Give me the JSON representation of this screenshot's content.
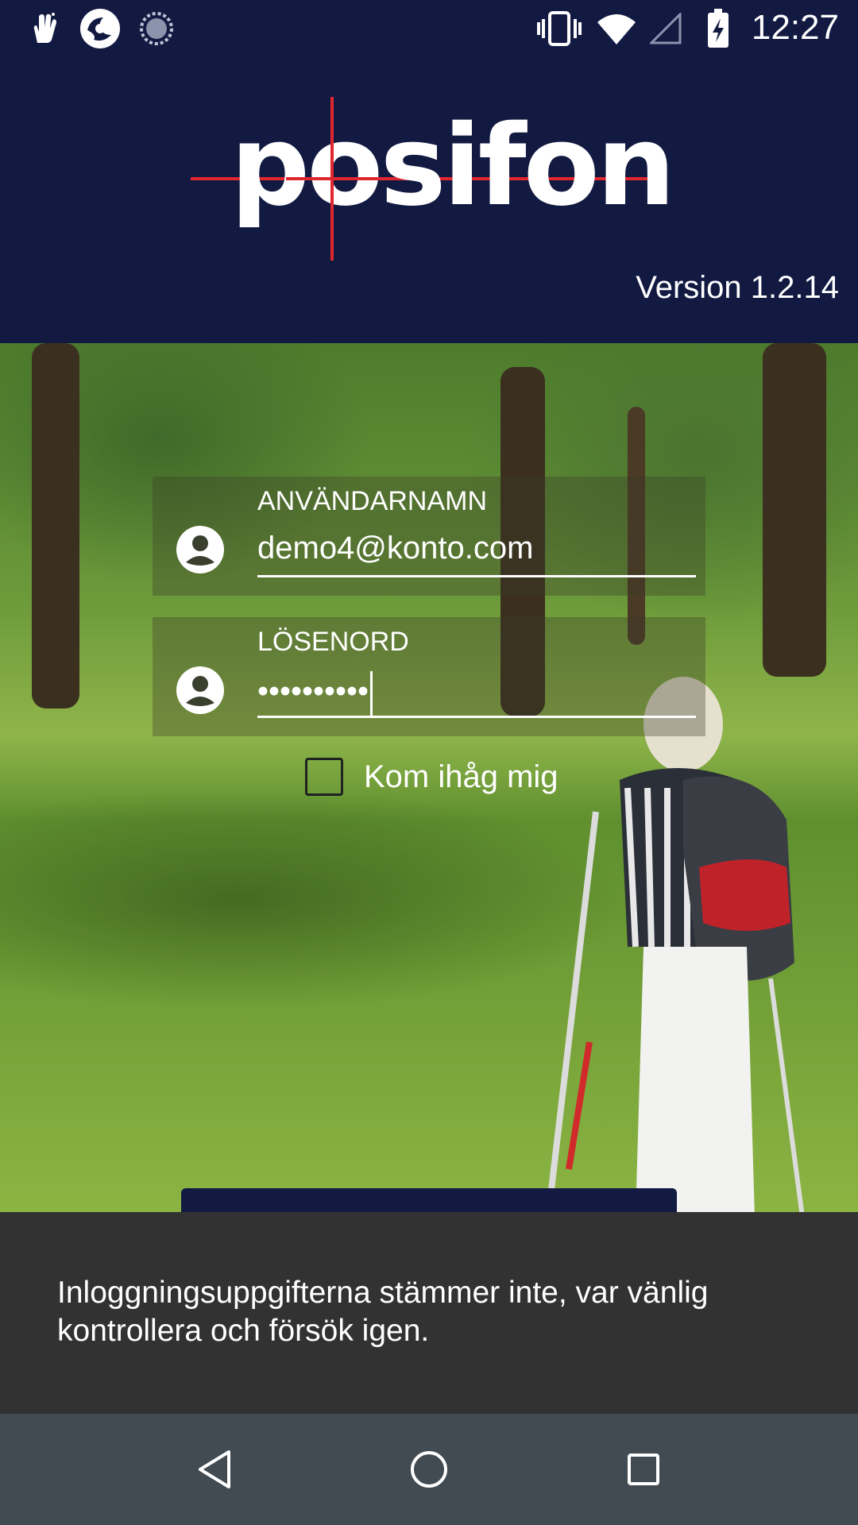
{
  "status_bar": {
    "time": "12:27",
    "icons": [
      "hand-notification-icon",
      "app-notification-icon",
      "sync-notification-icon",
      "vibrate-icon",
      "wifi-icon",
      "signal-icon",
      "battery-charging-icon"
    ]
  },
  "header": {
    "logo_text": "posifon",
    "version": "Version 1.2.14"
  },
  "login": {
    "username_label": "ANVÄNDARNAMN",
    "username_value": "demo4@konto.com",
    "password_label": "LÖSENORD",
    "password_value": "••••••••••",
    "remember_label": "Kom ihåg mig",
    "remember_checked": false
  },
  "snackbar": {
    "message": "Inloggningsuppgifterna stämmer inte, var vänlig kontrollera och försök igen."
  },
  "nav": {
    "icons": [
      "back-icon",
      "home-icon",
      "recents-icon"
    ]
  },
  "colors": {
    "header_bg": "#131a42",
    "snackbar_bg": "#323232",
    "navbar_bg": "#424a52",
    "logo_cross": "#e0262f"
  }
}
